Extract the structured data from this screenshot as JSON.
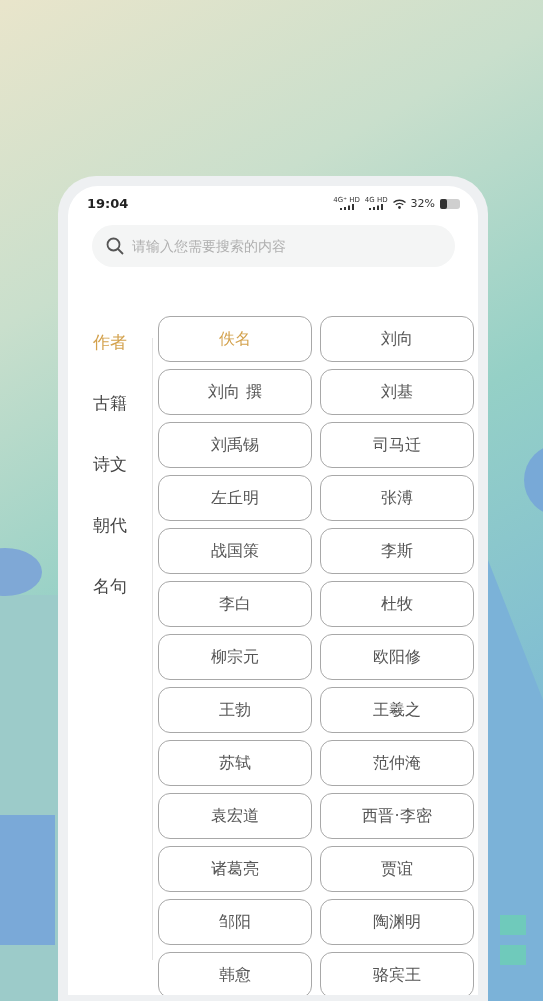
{
  "status_bar": {
    "time": "19:04",
    "networks": [
      "4G⁺ HD",
      "4G HD"
    ],
    "battery": "32%"
  },
  "search": {
    "placeholder": "请输入您需要搜索的内容"
  },
  "categories": [
    {
      "label": "作者",
      "selected": true
    },
    {
      "label": "古籍",
      "selected": false
    },
    {
      "label": "诗文",
      "selected": false
    },
    {
      "label": "朝代",
      "selected": false
    },
    {
      "label": "名句",
      "selected": false
    }
  ],
  "authors": [
    {
      "label": "佚名",
      "selected": true
    },
    {
      "label": "刘向",
      "selected": false
    },
    {
      "label": "刘向 撰",
      "selected": false
    },
    {
      "label": "刘基",
      "selected": false
    },
    {
      "label": "刘禹锡",
      "selected": false
    },
    {
      "label": "司马迁",
      "selected": false
    },
    {
      "label": "左丘明",
      "selected": false
    },
    {
      "label": "张溥",
      "selected": false
    },
    {
      "label": "战国策",
      "selected": false
    },
    {
      "label": "李斯",
      "selected": false
    },
    {
      "label": "李白",
      "selected": false
    },
    {
      "label": "杜牧",
      "selected": false
    },
    {
      "label": "柳宗元",
      "selected": false
    },
    {
      "label": "欧阳修",
      "selected": false
    },
    {
      "label": "王勃",
      "selected": false
    },
    {
      "label": "王羲之",
      "selected": false
    },
    {
      "label": "苏轼",
      "selected": false
    },
    {
      "label": "范仲淹",
      "selected": false
    },
    {
      "label": "袁宏道",
      "selected": false
    },
    {
      "label": "西晋·李密",
      "selected": false
    },
    {
      "label": "诸葛亮",
      "selected": false
    },
    {
      "label": "贾谊",
      "selected": false
    },
    {
      "label": "邹阳",
      "selected": false
    },
    {
      "label": "陶渊明",
      "selected": false
    },
    {
      "label": "韩愈",
      "selected": false
    },
    {
      "label": "骆宾王",
      "selected": false
    }
  ]
}
